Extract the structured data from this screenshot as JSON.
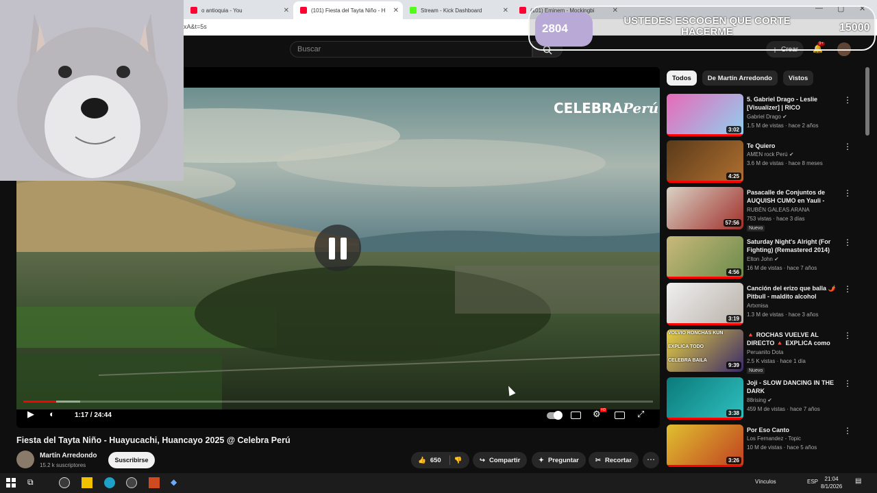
{
  "browser": {
    "tabs": [
      {
        "title": "o antioquia - You",
        "fav": "#ff0033"
      },
      {
        "title": "(101) Fiesta del Tayta Niño - H",
        "fav": "#ff0033",
        "active": true
      },
      {
        "title": "Stream - Kick Dashboard",
        "fav": "#53fc18"
      },
      {
        "title": "(101) Eminem - Mockingbi",
        "fav": "#ff0033"
      }
    ],
    "url": "xA&t=5s"
  },
  "youtube": {
    "search_placeholder": "Buscar",
    "create_label": "Crear",
    "notif_count": "9+"
  },
  "player": {
    "brand_text": "CELEBRA",
    "brand_script": "Perú",
    "time": "1:17 / 24:44",
    "progress_played": 0.052,
    "progress_buffered": 0.09,
    "hd_badge": "HD"
  },
  "video": {
    "title": "Fiesta del Tayta Niño - Huayucachi, Huancayo 2025 @ Celebra Perú",
    "channel": "Martín Arredondo",
    "subscribers": "15.2 k suscriptores",
    "subscribe_label": "Suscribirse",
    "likes": "650",
    "share_label": "Compartir",
    "ask_label": "Preguntar",
    "clip_label": "Recortar"
  },
  "sidebar": {
    "chips": [
      "Todos",
      "De Martín Arredondo",
      "Vistos"
    ],
    "recommendations": [
      {
        "title": "5. Gabriel Drago - Leslie [Visualizer] | RICO",
        "channel": "Gabriel Drago",
        "verified": true,
        "meta": "1.5 M de vistas · hace 2 años",
        "duration": "3:02",
        "progress": 1.0,
        "colors": [
          "#e86ab8",
          "#8fd0f0"
        ]
      },
      {
        "title": "Te Quiero",
        "channel": "AMEN rock Perú",
        "verified": true,
        "meta": "3.6 M de vistas · hace 8 meses",
        "duration": "4:25",
        "progress": 1.0,
        "colors": [
          "#5a3a1a",
          "#b07030"
        ]
      },
      {
        "title": "Pasacalle de Conjuntos de AUQUISH CUMO en Yauli - Jau...",
        "channel": "RUBÉN GALEAS ARANA",
        "verified": false,
        "meta": "753 vistas · hace 3 días",
        "badge": "Nuevo",
        "duration": "57:56",
        "progress": 0,
        "colors": [
          "#d9d2c5",
          "#a0302a"
        ]
      },
      {
        "title": "Saturday Night's Alright (For Fighting) (Remastered 2014)",
        "channel": "Elton John",
        "verified": true,
        "meta": "16 M de vistas · hace 7 años",
        "duration": "4:56",
        "progress": 1.0,
        "colors": [
          "#c9b97a",
          "#6a8a4a"
        ]
      },
      {
        "title": "Canción del erizo que balla 🌶️ Pitbull - maldito alcohol",
        "channel": "Artxmisa",
        "verified": false,
        "meta": "1.3 M de vistas · hace 3 años",
        "duration": "3:19",
        "progress": 1.0,
        "colors": [
          "#f0f0f0",
          "#b8b0a8"
        ]
      },
      {
        "title": "🔺 ROCHAS VUELVE AL DIRECTO 🔺 EXPLICA como la...",
        "channel": "Peruanito Dota",
        "verified": false,
        "meta": "2.5 K vistas · hace 1 día",
        "badge": "Nuevo",
        "duration": "9:39",
        "progress": 0,
        "colors": [
          "#e8d040",
          "#3a2a6a"
        ],
        "thumb_text": [
          "VOLVIO RONCHAS KUN",
          "EXPLICA TODO",
          "CELEBRA BAILA"
        ]
      },
      {
        "title": "Joji - SLOW DANCING IN THE DARK",
        "channel": "88rising",
        "verified": true,
        "meta": "459 M de vistas · hace 7 años",
        "duration": "3:38",
        "progress": 1.0,
        "colors": [
          "#0a7a7a",
          "#30c0c0"
        ]
      },
      {
        "title": "Por Eso Canto",
        "channel": "Los Fernandez - Topic",
        "verified": false,
        "meta": "10 M de vistas · hace 5 años",
        "duration": "3:26",
        "progress": 1.0,
        "colors": [
          "#e0c030",
          "#c04020"
        ]
      }
    ]
  },
  "stream_overlay": {
    "left_count": "2804",
    "title": "USTEDES ESCOGEN QUE CORTE HACERME",
    "right_count": "15000"
  },
  "taskbar": {
    "tray_links": "Vínculos",
    "lang": "ESP",
    "time": "21:04",
    "date": "8/1/2026"
  },
  "colors": {
    "accent": "#ff0000",
    "bg": "#0f0f0f",
    "overlay_purple": "#b8a9d6"
  }
}
